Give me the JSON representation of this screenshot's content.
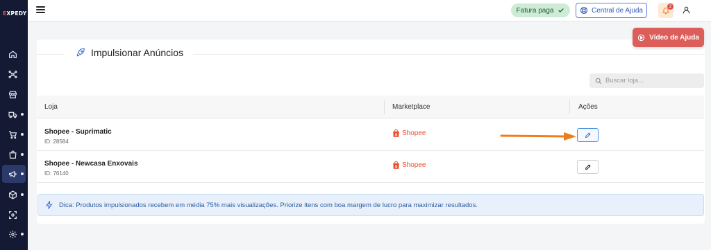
{
  "brand": {
    "logo_prefix": "E",
    "logo_rest": "XPEDY"
  },
  "topbar": {
    "status_badge": "Fatura paga",
    "help_center": "Central de Ajuda",
    "notifications_count": "2"
  },
  "sidebar": {
    "items": [
      {
        "icon": "home-icon",
        "has_submenu": false
      },
      {
        "icon": "network-icon",
        "has_submenu": false
      },
      {
        "icon": "store-icon",
        "has_submenu": false
      },
      {
        "icon": "truck-icon",
        "has_submenu": true
      },
      {
        "icon": "cart-icon",
        "has_submenu": true
      },
      {
        "icon": "bag-icon",
        "has_submenu": true
      },
      {
        "icon": "megaphone-icon",
        "has_submenu": true,
        "active": true
      },
      {
        "icon": "box-icon",
        "has_submenu": true
      },
      {
        "icon": "scan-icon",
        "has_submenu": false
      },
      {
        "icon": "gear-icon",
        "has_submenu": true
      }
    ]
  },
  "page": {
    "title": "Impulsionar Anúncios",
    "help_video_label": "Vídeo de Ajuda",
    "search_placeholder": "Buscar loja..."
  },
  "table": {
    "columns": [
      "Loja",
      "Marketplace",
      "Ações"
    ],
    "rows": [
      {
        "name": "Shopee - Suprimatic",
        "id": "ID: 28584",
        "marketplace": "Shopee"
      },
      {
        "name": "Shopee - Newcasa Enxovais",
        "id": "ID: 76140",
        "marketplace": "Shopee"
      }
    ]
  },
  "tip": "Dica: Produtos impulsionados recebem em média 75% mais visualizações. Priorize itens com boa margem de lucro para maximizar resultados.",
  "colors": {
    "sidebar": "#141a33",
    "accent_red": "#dc5e5b",
    "shopee": "#ee4d2d",
    "tip_bg": "#e8f1fb",
    "arrow": "#f07c1c"
  }
}
